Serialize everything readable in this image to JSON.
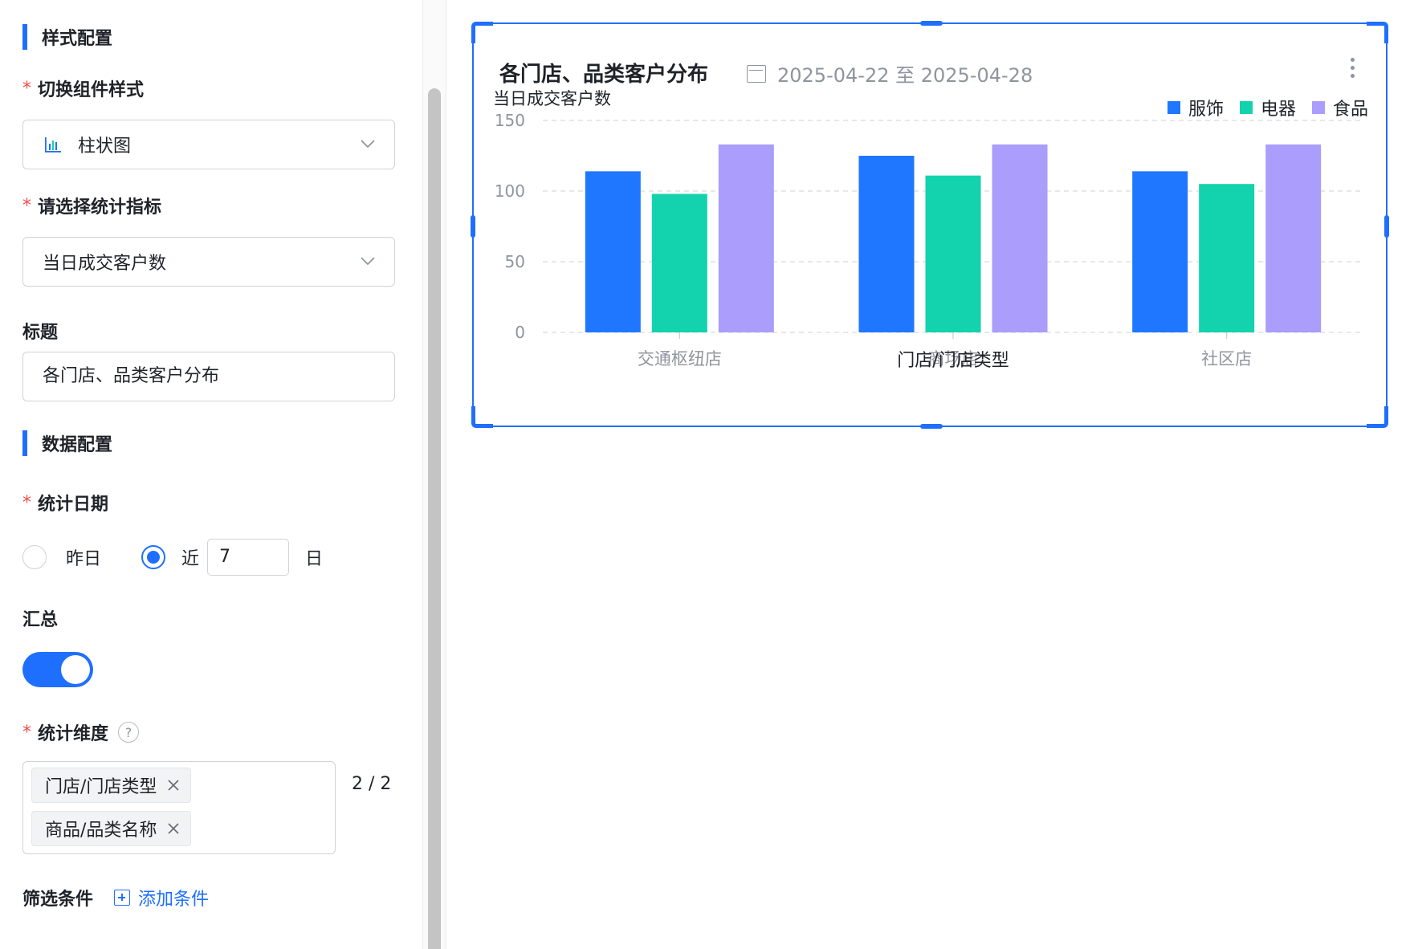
{
  "style_section": {
    "title": "样式配置"
  },
  "component_style": {
    "label": "切换组件样式",
    "value": "柱状图",
    "icon": "bar-chart-icon"
  },
  "metric": {
    "label": "请选择统计指标",
    "value": "当日成交客户数"
  },
  "title_field": {
    "label": "标题",
    "value": "各门店、品类客户分布"
  },
  "data_section": {
    "title": "数据配置"
  },
  "stat_date": {
    "label": "统计日期",
    "option_yesterday": "昨日",
    "option_recent_prefix": "近",
    "recent_days": "7",
    "option_recent_suffix": "日",
    "selected": "recent"
  },
  "summary": {
    "label": "汇总",
    "enabled": true
  },
  "dimension": {
    "label": "统计维度",
    "help": "?",
    "tags": [
      "门店/门店类型",
      "商品/品类名称"
    ],
    "counter": "2 / 2"
  },
  "filter": {
    "label": "筛选条件",
    "add_label": "添加条件"
  },
  "widget": {
    "title": "各门店、品类客户分布",
    "date_range": "2025-04-22 至 2025-04-28"
  },
  "colors": {
    "accent": "#1f6fff",
    "series1": "#1f77ff",
    "series2": "#12d3ad",
    "series3": "#aa9dfc"
  },
  "chart_data": {
    "type": "bar",
    "ylabel": "当日成交客户数",
    "xlabel": "门店/门店类型",
    "categories": [
      "交通枢纽店",
      "商场店",
      "社区店"
    ],
    "series": [
      {
        "name": "服饰",
        "values": [
          114,
          125,
          114
        ]
      },
      {
        "name": "电器",
        "values": [
          98,
          111,
          105
        ]
      },
      {
        "name": "食品",
        "values": [
          133,
          133,
          133
        ]
      }
    ],
    "ylim": [
      0,
      150
    ],
    "yticks": [
      0,
      50,
      100,
      150
    ],
    "grid": true,
    "legend": "top-right"
  }
}
